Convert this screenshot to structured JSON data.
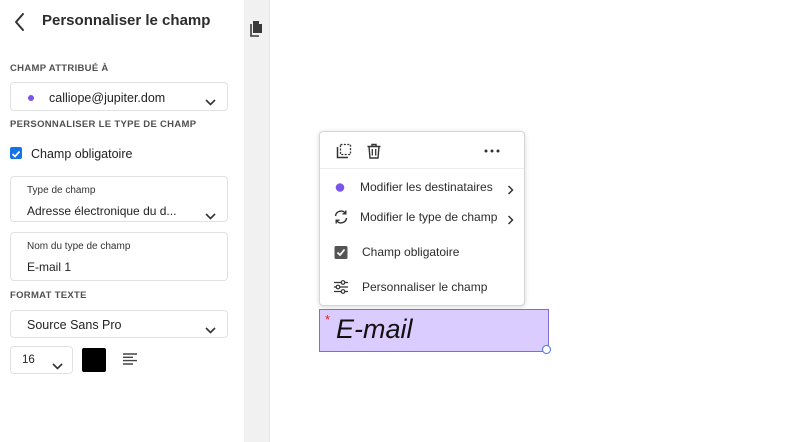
{
  "panel": {
    "title": "Personnaliser le champ",
    "assigned_section": "CHAMP ATTRIBUÉ À",
    "assignee": {
      "email": "calliope@jupiter.dom",
      "dot_color": "#7b55e8"
    },
    "type_section": "PERSONNALISER LE TYPE DE CHAMP",
    "required_checkbox": {
      "label": "Champ obligatoire",
      "checked": true
    },
    "field_type": {
      "label": "Type de champ",
      "value": "Adresse électronique du d..."
    },
    "field_name": {
      "label": "Nom du type de champ",
      "value": "E-mail 1"
    },
    "text_format_section": "FORMAT TEXTE",
    "font": {
      "value": "Source Sans Pro"
    },
    "font_size": {
      "value": "16"
    },
    "text_color": "#000000",
    "icons": [
      "back-icon",
      "chevron-down-icon",
      "align-icon"
    ]
  },
  "rail": {
    "icons": [
      "document-icon"
    ]
  },
  "popover": {
    "toolbar_icons": [
      "duplicate-icon",
      "trash-icon",
      "more-icon"
    ],
    "more_label": "...",
    "items": [
      {
        "label": "Modifier les destinataires",
        "icon": "recipient-dot-icon",
        "has_submenu": true
      },
      {
        "label": "Modifier le type de champ",
        "icon": "refresh-icon",
        "has_submenu": true
      },
      {
        "label": "Champ obligatoire",
        "icon": "checkbox-icon",
        "has_submenu": false
      },
      {
        "label": "Personnaliser le champ",
        "icon": "sliders-icon",
        "has_submenu": false
      }
    ]
  },
  "field": {
    "text": "E-mail",
    "required_mark": "*",
    "background": "#dbccff"
  },
  "colors": {
    "accent": "#1473e6",
    "recipient": "#7b55e8",
    "required": "#e02020"
  }
}
